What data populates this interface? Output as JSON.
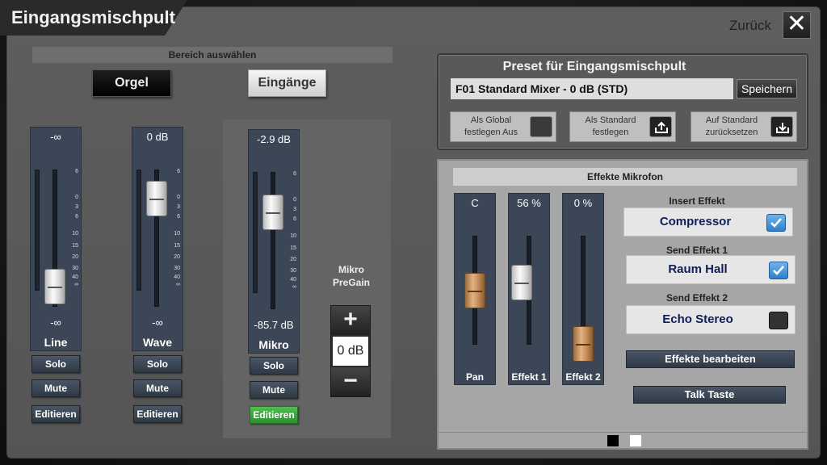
{
  "window": {
    "title": "Eingangsmischpult",
    "back_label": "Zurück",
    "close_glyph": "✕"
  },
  "area_select": {
    "header": "Bereich auswählen",
    "buttons": [
      "Orgel",
      "Eingänge"
    ],
    "selected": "Eingänge"
  },
  "channels": [
    {
      "name": "Line",
      "top_value": "-∞",
      "bottom_value": "-∞",
      "buttons": [
        "Solo",
        "Mute",
        "Editieren"
      ]
    },
    {
      "name": "Wave",
      "top_value": "0 dB",
      "bottom_value": "-∞",
      "buttons": [
        "Solo",
        "Mute",
        "Editieren"
      ]
    },
    {
      "name": "Mikro",
      "top_value": "-2.9 dB",
      "bottom_value": "-85.7 dB",
      "buttons": [
        "Solo",
        "Mute",
        "Editieren"
      ],
      "edit_active": true
    }
  ],
  "fader_scale": [
    "6",
    "0",
    "3",
    "6",
    "10",
    "15",
    "20",
    "30",
    "40",
    "∞"
  ],
  "pregain": {
    "label_line1": "Mikro",
    "label_line2": "PreGain",
    "plus": "+",
    "minus": "−",
    "value": "0 dB"
  },
  "preset": {
    "title": "Preset für Eingangsmischpult",
    "current": "F01 Standard Mixer - 0 dB (STD)",
    "save_label": "Speichern",
    "options": [
      {
        "line1": "Als Global",
        "line2": "festlegen Aus",
        "icon": "checkbox-empty-icon"
      },
      {
        "line1": "Als Standard",
        "line2": "festlegen",
        "icon": "upload-icon"
      },
      {
        "line1": "Auf Standard",
        "line2": "zurücksetzen",
        "icon": "download-icon"
      }
    ]
  },
  "effects": {
    "header": "Effekte Mikrofon",
    "faders": [
      {
        "name": "Pan",
        "value": "C"
      },
      {
        "name": "Effekt 1",
        "value": "56 %"
      },
      {
        "name": "Effekt 2",
        "value": "0 %"
      }
    ],
    "slots": [
      {
        "label": "Insert Effekt",
        "name": "Compressor",
        "enabled": true
      },
      {
        "label": "Send Effekt 1",
        "name": "Raum Hall",
        "enabled": true
      },
      {
        "label": "Send Effekt 2",
        "name": "Echo Stereo",
        "enabled": false
      }
    ],
    "edit_button": "Effekte bearbeiten",
    "talk_button": "Talk Taste"
  },
  "pagination": {
    "pages": 2,
    "current": 1
  },
  "colors": {
    "accent_blue": "#2f7fc8",
    "edit_green": "#3ca83c",
    "channel_bg": "#3b4756",
    "effect_text": "#0f1e58"
  }
}
